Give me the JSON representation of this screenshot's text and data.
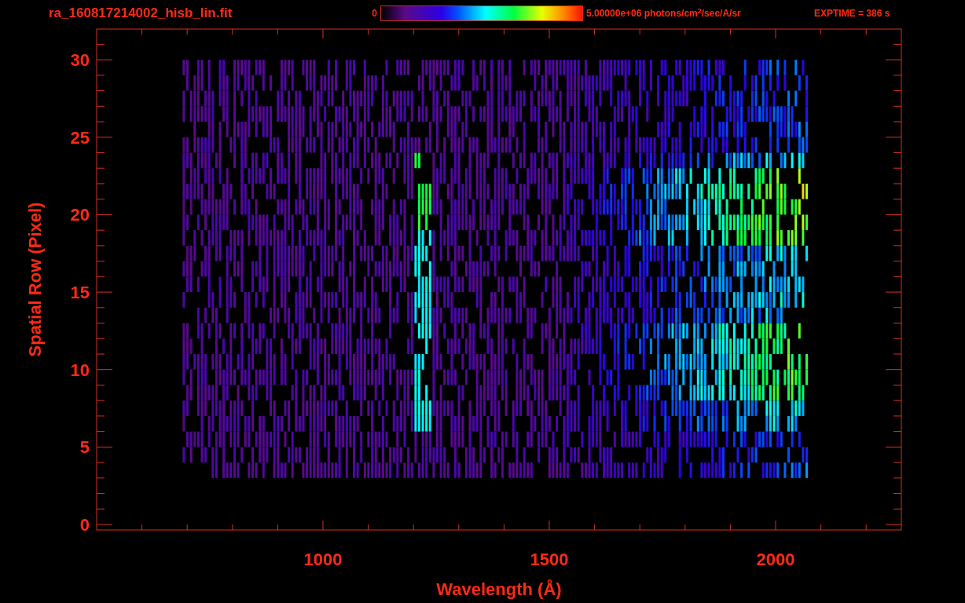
{
  "title": "ra_160817214002_hisb_lin.fit",
  "colorbar": {
    "min_label": "0",
    "max_label": "5.00000e+06 photons/cm$^{2}$/sec/A/sr"
  },
  "exposure": "EXPTIME = 386 s",
  "x_axis": {
    "label": "Wavelength (Å)",
    "tick_labels": [
      "1000",
      "1500",
      "2000"
    ]
  },
  "y_axis": {
    "label": "Spatial Row (Pixel)",
    "tick_labels": [
      "30",
      "25",
      "20",
      "15",
      "10",
      "5",
      "0"
    ]
  }
}
